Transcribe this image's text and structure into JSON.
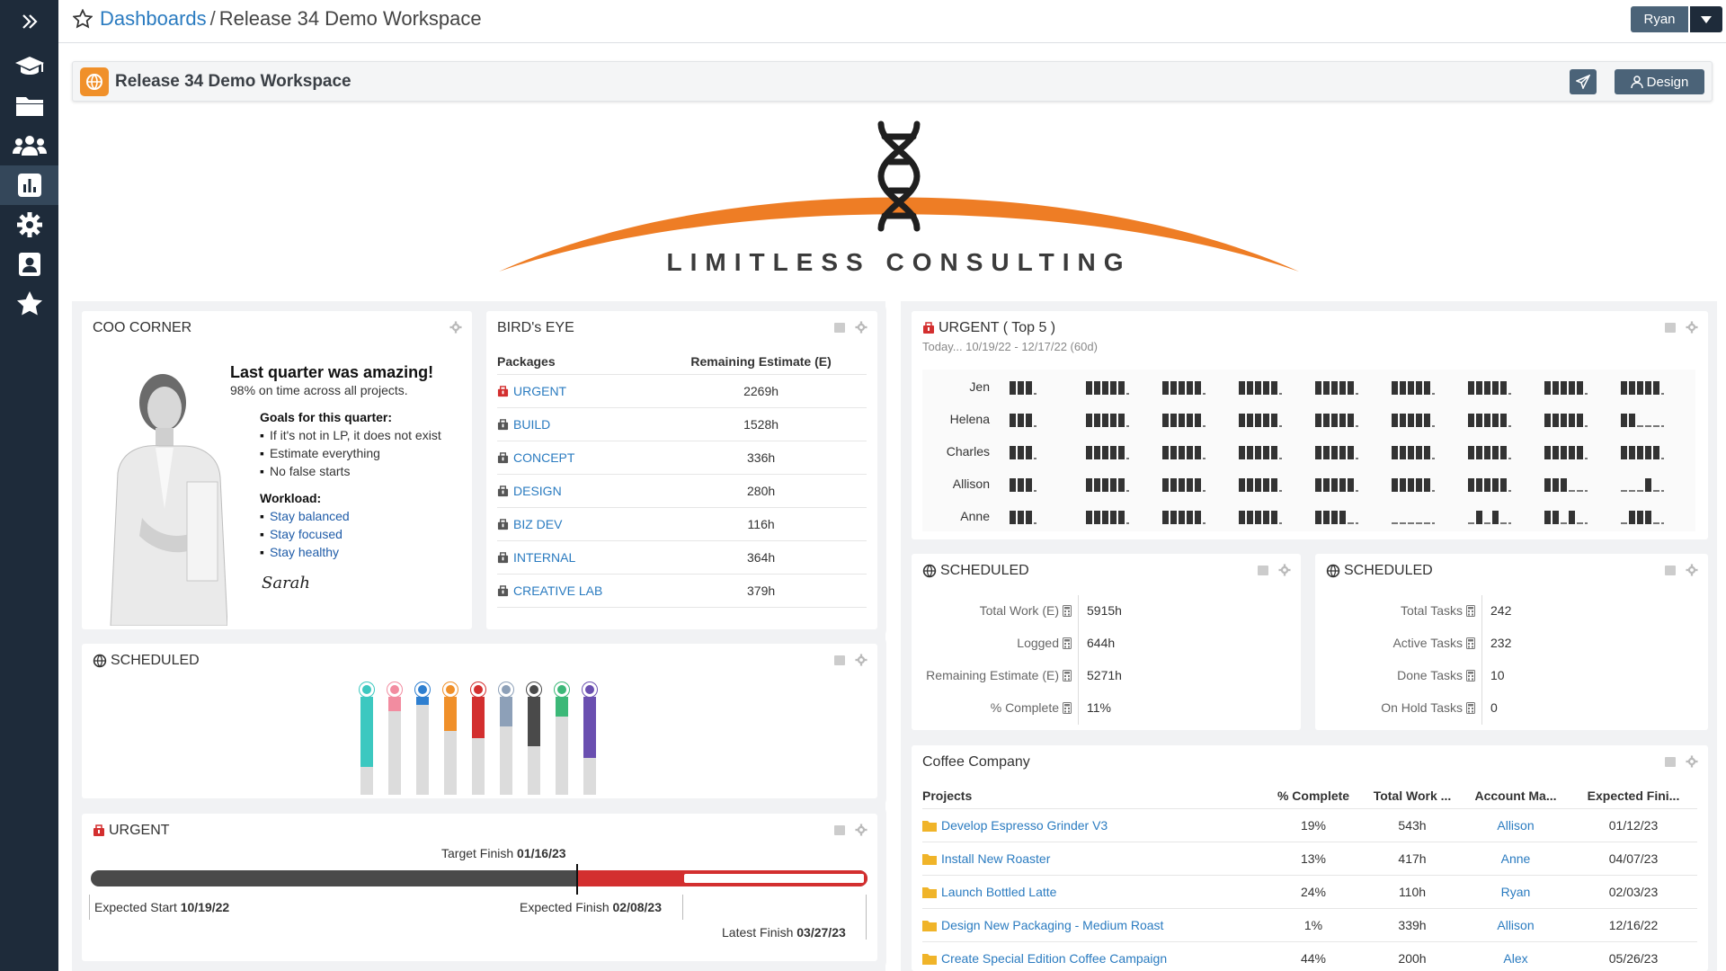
{
  "breadcrumb": {
    "parent": "Dashboards",
    "separator": "/",
    "current": "Release 34 Demo Workspace"
  },
  "user": {
    "name": "Ryan"
  },
  "workspace": {
    "title": "Release 34 Demo Workspace",
    "design_label": "Design"
  },
  "logo": {
    "text": "LIMITLESS CONSULTING"
  },
  "sidebar": {
    "items": [
      {
        "icon": "chevrons-right-icon"
      },
      {
        "icon": "graduation-cap-icon"
      },
      {
        "icon": "folder-icon"
      },
      {
        "icon": "users-icon"
      },
      {
        "icon": "chart-icon",
        "active": true
      },
      {
        "icon": "gear-icon"
      },
      {
        "icon": "contact-card-icon"
      },
      {
        "icon": "star-icon"
      }
    ]
  },
  "coo": {
    "title": "COO CORNER",
    "heading": "Last quarter was amazing!",
    "sub": "98% on time across all projects.",
    "goals_title": "Goals for this quarter:",
    "goals": [
      "If it's not in LP, it does not exist",
      "Estimate everything",
      "No false starts"
    ],
    "workload_title": "Workload:",
    "workload": [
      "Stay balanced",
      "Stay focused",
      "Stay healthy"
    ],
    "signature": "Sarah"
  },
  "birds_eye": {
    "title": "BIRD's EYE",
    "col1": "Packages",
    "col2": "Remaining Estimate (E)",
    "rows": [
      {
        "name": "URGENT",
        "value": "2269h",
        "color": "#d32f2f"
      },
      {
        "name": "BUILD",
        "value": "1528h",
        "color": "#555555"
      },
      {
        "name": "CONCEPT",
        "value": "336h",
        "color": "#555555"
      },
      {
        "name": "DESIGN",
        "value": "280h",
        "color": "#555555"
      },
      {
        "name": "BIZ DEV",
        "value": "116h",
        "color": "#555555"
      },
      {
        "name": "INTERNAL",
        "value": "364h",
        "color": "#555555"
      },
      {
        "name": "CREATIVE LAB",
        "value": "379h",
        "color": "#555555"
      }
    ]
  },
  "urgent_top5": {
    "title": "URGENT ( Top 5 )",
    "subtitle": "Today... 10/19/22 - 12/17/22 (60d)",
    "people": [
      {
        "name": "Jen",
        "pattern": [
          "111",
          "11111",
          "11111",
          "11111",
          "11111",
          "11111",
          "11111",
          "11111",
          "11111"
        ]
      },
      {
        "name": "Helena",
        "pattern": [
          "111",
          "11111",
          "11111",
          "11111",
          "11111",
          "11111",
          "11111",
          "11111",
          "11000"
        ]
      },
      {
        "name": "Charles",
        "pattern": [
          "111",
          "11111",
          "11111",
          "11111",
          "11111",
          "11111",
          "11111",
          "11111",
          "11111"
        ]
      },
      {
        "name": "Allison",
        "pattern": [
          "111",
          "11111",
          "11111",
          "11111",
          "11111",
          "11111",
          "11111",
          "11100",
          "00010"
        ]
      },
      {
        "name": "Anne",
        "pattern": [
          "111",
          "11111",
          "11111",
          "11111",
          "11110",
          "00000",
          "01010",
          "11010",
          "01110"
        ]
      }
    ]
  },
  "scheduled_work": {
    "title": "SCHEDULED",
    "rows": [
      {
        "label": "Total Work (E)",
        "value": "5915h"
      },
      {
        "label": "Logged",
        "value": "644h"
      },
      {
        "label": "Remaining Estimate (E)",
        "value": "5271h"
      },
      {
        "label": "% Complete",
        "value": "11%"
      }
    ]
  },
  "scheduled_tasks": {
    "title": "SCHEDULED",
    "rows": [
      {
        "label": "Total Tasks",
        "value": "242"
      },
      {
        "label": "Active Tasks",
        "value": "232"
      },
      {
        "label": "Done Tasks",
        "value": "10"
      },
      {
        "label": "On Hold Tasks",
        "value": "0"
      }
    ]
  },
  "scheduled_chart": {
    "title": "SCHEDULED",
    "columns": [
      {
        "color": "#3cc8c0",
        "fill": 0.72
      },
      {
        "color": "#f28ca0",
        "fill": 0.15
      },
      {
        "color": "#2e7fd0",
        "fill": 0.08
      },
      {
        "color": "#f0902a",
        "fill": 0.35
      },
      {
        "color": "#d32f2f",
        "fill": 0.42
      },
      {
        "color": "#8da0b8",
        "fill": 0.3
      },
      {
        "color": "#4a4a4a",
        "fill": 0.5
      },
      {
        "color": "#3cb878",
        "fill": 0.2
      },
      {
        "color": "#6a4fb0",
        "fill": 0.62
      }
    ]
  },
  "urgent_timeline": {
    "title": "URGENT",
    "target_label": "Target Finish",
    "target_date": "01/16/23",
    "start_label": "Expected Start",
    "start_date": "10/19/22",
    "finish_label": "Expected Finish",
    "finish_date": "02/08/23",
    "latest_label": "Latest Finish",
    "latest_date": "03/27/23"
  },
  "coffee": {
    "title": "Coffee Company",
    "headers": [
      "Projects",
      "% Complete",
      "Total Work ...",
      "Account Ma...",
      "Expected Fini..."
    ],
    "rows": [
      {
        "project": "Develop Espresso Grinder V3",
        "pct": "19%",
        "work": "543h",
        "manager": "Allison",
        "finish": "01/12/23"
      },
      {
        "project": "Install New Roaster",
        "pct": "13%",
        "work": "417h",
        "manager": "Anne",
        "finish": "04/07/23"
      },
      {
        "project": "Launch Bottled Latte",
        "pct": "24%",
        "work": "110h",
        "manager": "Ryan",
        "finish": "02/03/23"
      },
      {
        "project": "Design New Packaging - Medium Roast",
        "pct": "1%",
        "work": "339h",
        "manager": "Allison",
        "finish": "12/16/22"
      },
      {
        "project": "Create Special Edition Coffee Campaign",
        "pct": "44%",
        "work": "200h",
        "manager": "Alex",
        "finish": "05/26/23"
      }
    ]
  }
}
